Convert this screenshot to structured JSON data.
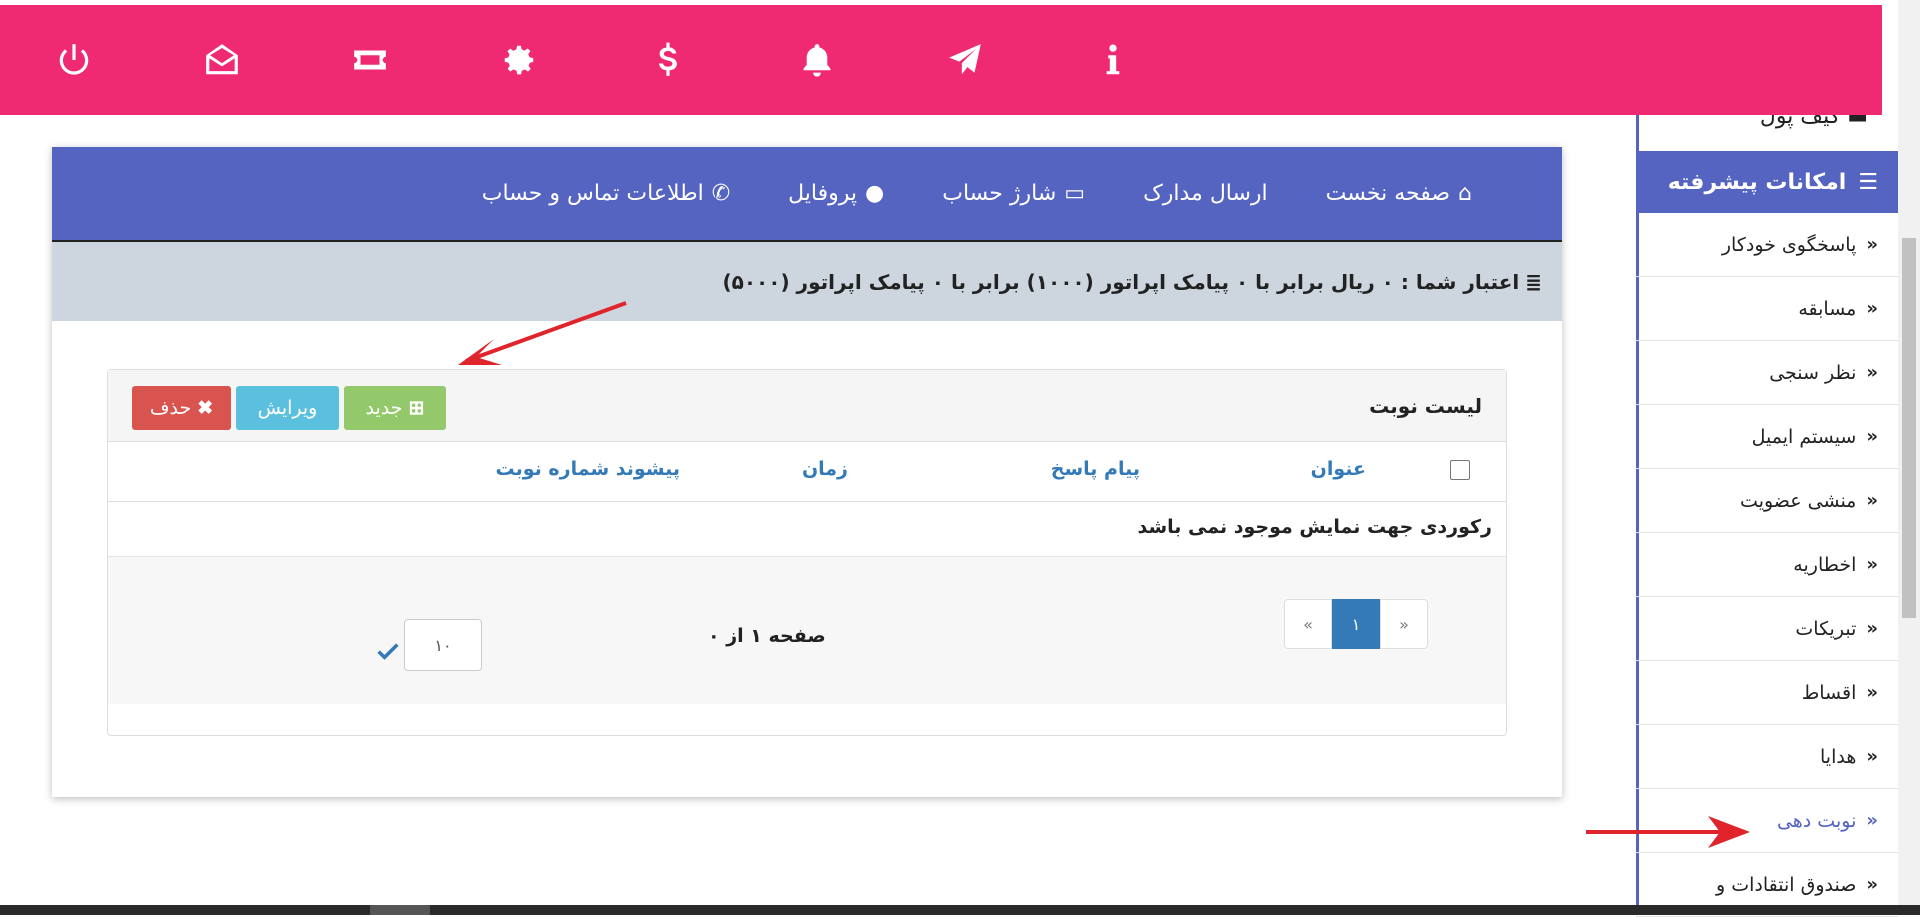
{
  "topbar": {
    "icons": [
      "power-icon",
      "envelope-open-icon",
      "ticket-icon",
      "gear-icon",
      "dollar-icon",
      "bell-icon",
      "paper-plane-icon",
      "info-icon"
    ]
  },
  "sidebar": {
    "prev_item": "کیف پول",
    "section_title": "امکانات پیشرفته",
    "items": [
      {
        "label": "پاسخگوی خودکار"
      },
      {
        "label": "مسابقه"
      },
      {
        "label": "نظر سنجی"
      },
      {
        "label": "سیستم ایمیل"
      },
      {
        "label": "منشی عضویت"
      },
      {
        "label": "اخطاریه"
      },
      {
        "label": "تبریکات"
      },
      {
        "label": "اقساط"
      },
      {
        "label": "هدایا"
      },
      {
        "label": "نوبت دهی"
      },
      {
        "label": "صندوق انتقادات و"
      }
    ]
  },
  "nav": {
    "home": "صفحه نخست",
    "documents": "ارسال مدارک",
    "charge": "شارژ حساب",
    "profile": "پروفایل",
    "contact": "اطلاعات تماس و حساب"
  },
  "credit": {
    "text": "اعتبار شما : ۰ ریال برابر با ۰ پیامک اپراتور (۱۰۰۰) برابر با ۰ پیامک اپراتور (۵۰۰۰)"
  },
  "panel": {
    "title": "لیست نوبت",
    "buttons": {
      "new": "جدید",
      "edit": "ویرایش",
      "delete": "حذف"
    },
    "columns": {
      "title": "عنوان",
      "reply": "پیام پاسخ",
      "time": "زمان",
      "prefix": "پیشوند شماره نوبت"
    },
    "empty_message": "رکوردی جهت نمایش موجود نمی باشد",
    "pager": {
      "prev": "«",
      "current": "۱",
      "next": "»"
    },
    "page_info": "صفحه ۱ از ۰",
    "page_size": "۱۰"
  },
  "colors": {
    "topbar": "#ef2a73",
    "primary": "#5563c1",
    "credit_bg": "#cdd6de",
    "btn_new": "#93c96a",
    "btn_edit": "#5bc0de",
    "btn_delete": "#d9534f",
    "arrow": "#e0242c"
  }
}
